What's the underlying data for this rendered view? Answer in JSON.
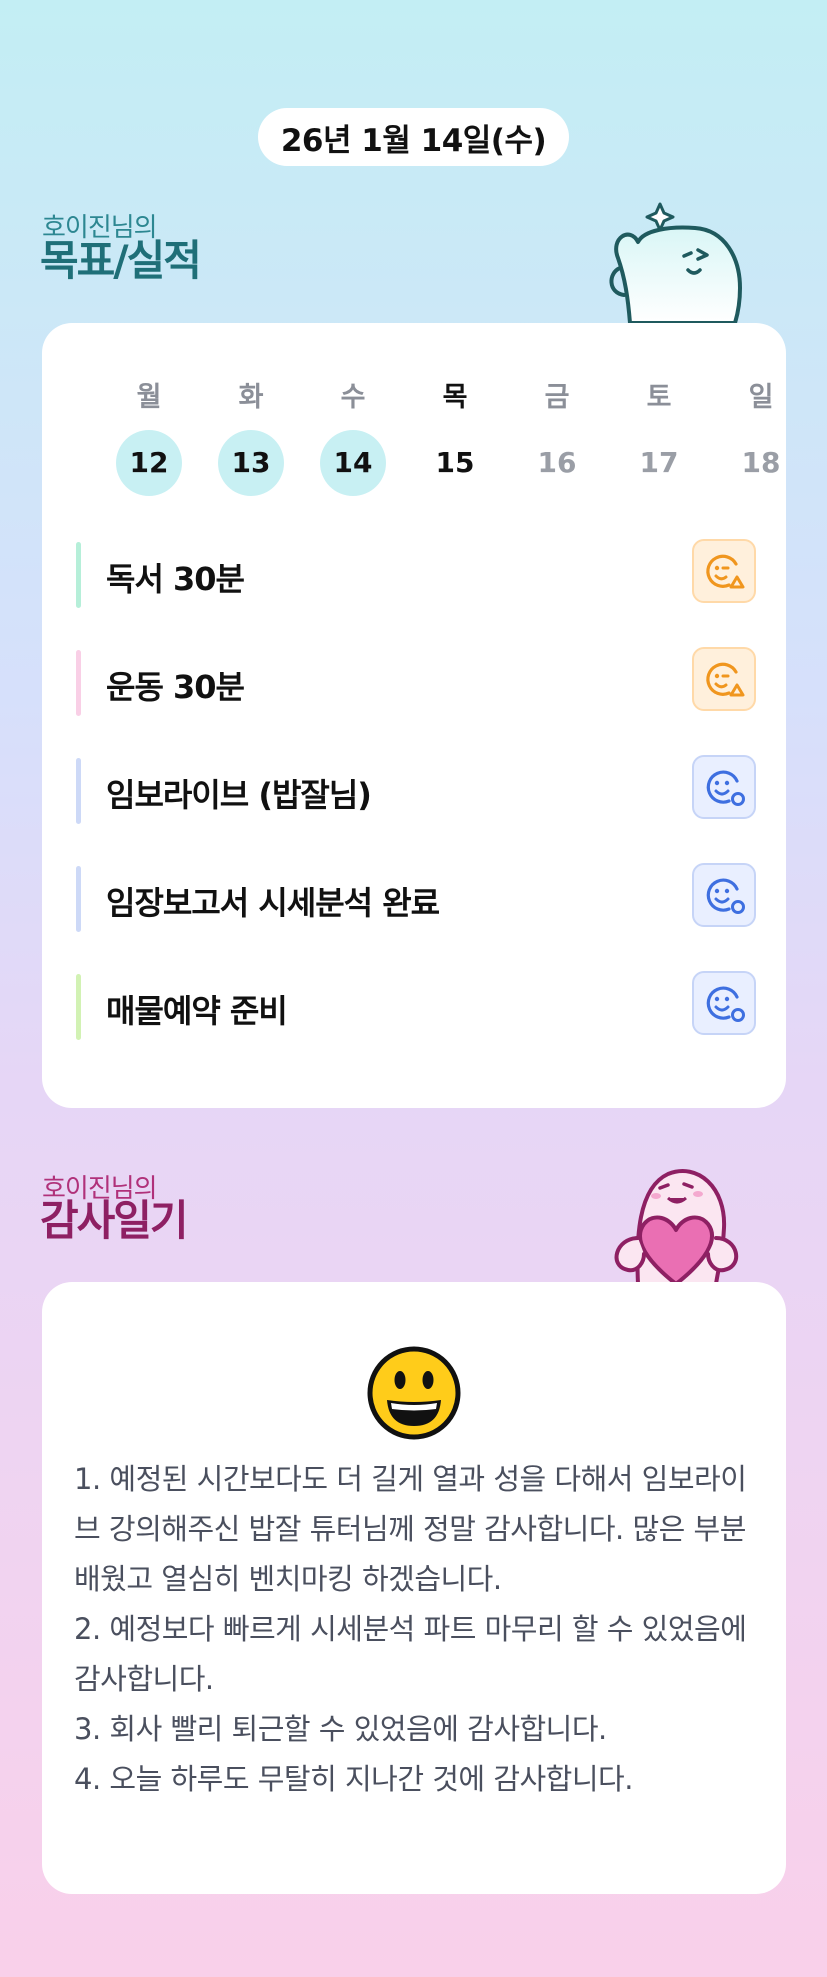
{
  "header": {
    "date": "26년 1월 14일(수)"
  },
  "goals_section": {
    "subtitle": "호이진님의",
    "title": "목표/실적",
    "days": [
      {
        "dow": "월",
        "num": "12",
        "state": "done"
      },
      {
        "dow": "화",
        "num": "13",
        "state": "done"
      },
      {
        "dow": "수",
        "num": "14",
        "state": "done"
      },
      {
        "dow": "목",
        "num": "15",
        "state": "today"
      },
      {
        "dow": "금",
        "num": "16",
        "state": "future"
      },
      {
        "dow": "토",
        "num": "17",
        "state": "future"
      },
      {
        "dow": "일",
        "num": "18",
        "state": "future"
      }
    ],
    "goals": [
      {
        "label": "독서 30분",
        "bar_color": "#b6efd9",
        "status_icon": "face-triangle-icon",
        "status_color": "#f0961e"
      },
      {
        "label": "운동 30분",
        "bar_color": "#f9cfe6",
        "status_icon": "face-triangle-icon",
        "status_color": "#f0961e"
      },
      {
        "label": "임보라이브 (밥잘님)",
        "bar_color": "#cdd9f7",
        "status_icon": "face-circle-icon",
        "status_color": "#3e6fe0"
      },
      {
        "label": "임장보고서 시세분석 완료",
        "bar_color": "#cdd9f7",
        "status_icon": "face-circle-icon",
        "status_color": "#3e6fe0"
      },
      {
        "label": "매물예약 준비",
        "bar_color": "#d2f2b4",
        "status_icon": "face-circle-icon",
        "status_color": "#3e6fe0"
      }
    ]
  },
  "thanks_section": {
    "subtitle": "호이진님의",
    "title": "감사일기",
    "emoji": "grinning-face-icon",
    "text": "1. 예정된 시간보다도 더 길게 열과 성을 다해서 임보라이브 강의해주신 밥잘 튜터님께 정말 감사합니다. 많은 부분 배웠고 열심히 벤치마킹 하겠습니다.\n2. 예정보다 빠르게 시세분석 파트 마무리 할 수 있었음에 감사합니다.\n3. 회사 빨리 퇴근할 수 있었음에 감사합니다.\n4. 오늘 하루도 무탈히 지나간 것에 감사합니다."
  },
  "colors": {
    "goals_title": "#1f6f78",
    "thanks_title": "#8e2063",
    "done_day_bg": "#c8f0f3"
  }
}
